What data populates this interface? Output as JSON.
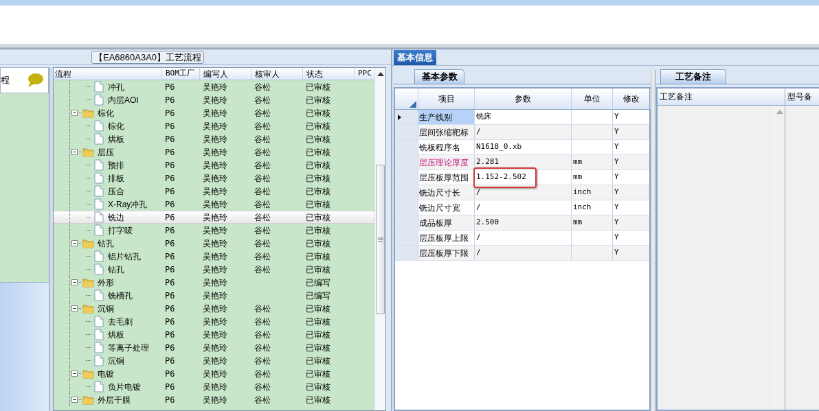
{
  "sidebar": {
    "items": [
      {
        "label": "程"
      }
    ]
  },
  "process_group": {
    "title": "【EA6860A3A0】工艺流程"
  },
  "tree": {
    "columns": [
      "流程",
      "BOM工厂",
      "编写人",
      "核审人",
      "状态",
      "PPC"
    ],
    "rows": [
      {
        "kind": "step",
        "name": "冲孔",
        "factory": "P6",
        "author": "吴艳玲",
        "reviewer": "谷松",
        "status": "已审核",
        "selected": false
      },
      {
        "kind": "step",
        "name": "内层AOI",
        "factory": "P6",
        "author": "吴艳玲",
        "reviewer": "谷松",
        "status": "已审核",
        "selected": false
      },
      {
        "kind": "group",
        "name": "棕化",
        "factory": "P6",
        "author": "吴艳玲",
        "reviewer": "谷松",
        "status": "已审核",
        "selected": false,
        "expanded": true,
        "children": [
          {
            "kind": "step",
            "name": "棕化",
            "factory": "P6",
            "author": "吴艳玲",
            "reviewer": "谷松",
            "status": "已审核",
            "selected": false
          },
          {
            "kind": "step",
            "name": "烘板",
            "factory": "P6",
            "author": "吴艳玲",
            "reviewer": "谷松",
            "status": "已审核",
            "selected": false
          }
        ]
      },
      {
        "kind": "group",
        "name": "层压",
        "factory": "P6",
        "author": "吴艳玲",
        "reviewer": "谷松",
        "status": "已审核",
        "selected": false,
        "expanded": true,
        "children": [
          {
            "kind": "step",
            "name": "预排",
            "factory": "P6",
            "author": "吴艳玲",
            "reviewer": "谷松",
            "status": "已审核",
            "selected": false
          },
          {
            "kind": "step",
            "name": "排板",
            "factory": "P6",
            "author": "吴艳玲",
            "reviewer": "谷松",
            "status": "已审核",
            "selected": false
          },
          {
            "kind": "step",
            "name": "压合",
            "factory": "P6",
            "author": "吴艳玲",
            "reviewer": "谷松",
            "status": "已审核",
            "selected": false
          },
          {
            "kind": "step",
            "name": "X-Ray冲孔",
            "factory": "P6",
            "author": "吴艳玲",
            "reviewer": "谷松",
            "status": "已审核",
            "selected": false
          },
          {
            "kind": "step",
            "name": "铣边",
            "factory": "P6",
            "author": "吴艳玲",
            "reviewer": "谷松",
            "status": "已审核",
            "selected": true
          },
          {
            "kind": "step",
            "name": "打字唛",
            "factory": "P6",
            "author": "吴艳玲",
            "reviewer": "谷松",
            "status": "已审核",
            "selected": false
          }
        ]
      },
      {
        "kind": "group",
        "name": "钻孔",
        "factory": "P6",
        "author": "吴艳玲",
        "reviewer": "谷松",
        "status": "已审核",
        "selected": false,
        "expanded": true,
        "children": [
          {
            "kind": "step",
            "name": "铝片钻孔",
            "factory": "P6",
            "author": "吴艳玲",
            "reviewer": "谷松",
            "status": "已审核",
            "selected": false
          },
          {
            "kind": "step",
            "name": "钻孔",
            "factory": "P6",
            "author": "吴艳玲",
            "reviewer": "谷松",
            "status": "已审核",
            "selected": false
          }
        ]
      },
      {
        "kind": "group",
        "name": "外形",
        "factory": "P6",
        "author": "吴艳玲",
        "status": "已编写",
        "selected": false,
        "expanded": true,
        "children": [
          {
            "kind": "step",
            "name": "铣槽孔",
            "factory": "P6",
            "author": "吴艳玲",
            "status": "已编写",
            "selected": false
          }
        ]
      },
      {
        "kind": "group",
        "name": "沉铜",
        "factory": "P6",
        "author": "吴艳玲",
        "reviewer": "谷松",
        "status": "已审核",
        "selected": false,
        "expanded": true,
        "children": [
          {
            "kind": "step",
            "name": "去毛刺",
            "factory": "P6",
            "author": "吴艳玲",
            "reviewer": "谷松",
            "status": "已审核",
            "selected": false
          },
          {
            "kind": "step",
            "name": "烘板",
            "factory": "P6",
            "author": "吴艳玲",
            "reviewer": "谷松",
            "status": "已审核",
            "selected": false
          },
          {
            "kind": "step",
            "name": "等离子处理",
            "factory": "P6",
            "author": "吴艳玲",
            "reviewer": "谷松",
            "status": "已审核",
            "selected": false
          },
          {
            "kind": "step",
            "name": "沉铜",
            "factory": "P6",
            "author": "吴艳玲",
            "reviewer": "谷松",
            "status": "已审核",
            "selected": false
          }
        ]
      },
      {
        "kind": "group",
        "name": "电镀",
        "factory": "P6",
        "author": "吴艳玲",
        "reviewer": "谷松",
        "status": "已审核",
        "selected": false,
        "expanded": true,
        "children": [
          {
            "kind": "step",
            "name": "负片电镀",
            "factory": "P6",
            "author": "吴艳玲",
            "reviewer": "谷松",
            "status": "已审核",
            "selected": false
          }
        ]
      },
      {
        "kind": "group",
        "name": "外层干膜",
        "factory": "P6",
        "author": "吴艳玲",
        "reviewer": "谷松",
        "status": "已审核",
        "selected": false,
        "expanded": true
      }
    ]
  },
  "tabs": [
    {
      "label": "基本信息",
      "selected": true
    }
  ],
  "params_panel": {
    "tab": {
      "label": "基本参数",
      "selected": true
    },
    "columns": [
      "项目",
      "参数",
      "单位",
      "修改"
    ],
    "rows": [
      {
        "item": "生产线别",
        "value": "铣床",
        "modify": "Y",
        "current": true,
        "emphasized": false
      },
      {
        "item": "层间张缩靶标",
        "value": "/",
        "modify": "Y",
        "current": false,
        "emphasized": false
      },
      {
        "item": "铣板程序名",
        "value": "N1618_0.xb",
        "modify": "Y",
        "current": false,
        "emphasized": false
      },
      {
        "item": "层压理论厚度",
        "value": "2.281",
        "unit": "mm",
        "modify": "Y",
        "current": false,
        "emphasized": true
      },
      {
        "item": "层压板厚范围",
        "value": "1.152-2.502",
        "unit": "mm",
        "modify": "Y",
        "current": false,
        "emphasized": false
      },
      {
        "item": "铣边尺寸长",
        "value": "/",
        "unit": "inch",
        "modify": "Y",
        "current": false,
        "emphasized": false
      },
      {
        "item": "铣边尺寸宽",
        "value": "/",
        "unit": "inch",
        "modify": "Y",
        "current": false,
        "emphasized": false
      },
      {
        "item": "成品板厚",
        "value": "2.500",
        "unit": "mm",
        "modify": "Y",
        "current": false,
        "emphasized": false
      },
      {
        "item": "层压板厚上限",
        "value": "/",
        "modify": "Y",
        "current": false,
        "emphasized": false
      },
      {
        "item": "层压板厚下限",
        "value": "/",
        "modify": "Y",
        "current": false,
        "emphasized": false
      }
    ]
  },
  "notes_panel": {
    "tab": {
      "label": "工艺备注",
      "selected": true
    },
    "columns": [
      "工艺备注",
      "型号备"
    ]
  }
}
